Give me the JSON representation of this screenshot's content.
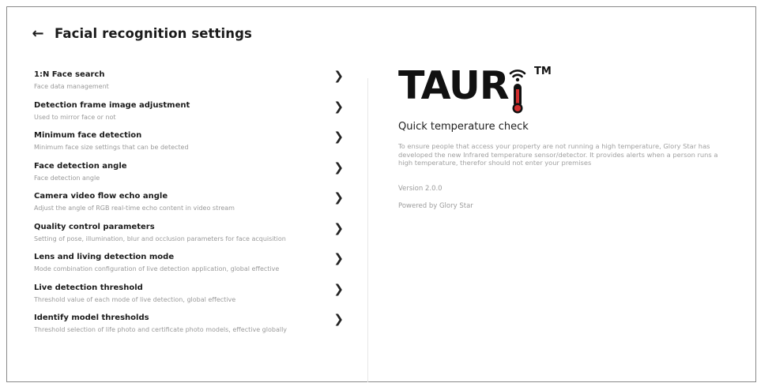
{
  "header": {
    "title": "Facial recognition settings",
    "back_icon": "arrow-left-icon"
  },
  "menu": [
    {
      "title": "1:N Face search",
      "subtitle": "Face data management"
    },
    {
      "title": "Detection frame image adjustment",
      "subtitle": "Used to mirror face or not"
    },
    {
      "title": "Minimum face detection",
      "subtitle": "Minimum face size settings that can be detected"
    },
    {
      "title": "Face detection angle",
      "subtitle": "Face detection angle"
    },
    {
      "title": "Camera video flow echo angle",
      "subtitle": "Adjust the angle of RGB real-time echo content in video stream"
    },
    {
      "title": "Quality control parameters",
      "subtitle": "Setting of pose, illumination, blur and occlusion parameters for face acquisition"
    },
    {
      "title": "Lens and living detection mode",
      "subtitle": "Mode combination configuration of live detection application, global effective"
    },
    {
      "title": "Live detection threshold",
      "subtitle": "Threshold value of each mode of live detection, global effective"
    },
    {
      "title": "Identify model thresholds",
      "subtitle": "Threshold selection of life photo and certificate photo models, effective globally"
    }
  ],
  "about": {
    "logo_text": "TAUR",
    "trademark": "TM",
    "subtitle": "Quick temperature check",
    "description": "To ensure people that access your property are not running a high temperature, Glory Star has developed the new Infrared temperature sensor/detector. It provides alerts when a person runs a high temperature, therefor should not enter your premises",
    "version": "Version 2.0.0",
    "powered_by": "Powered by Glory Star",
    "thermometer_color": "#d32f2f"
  }
}
